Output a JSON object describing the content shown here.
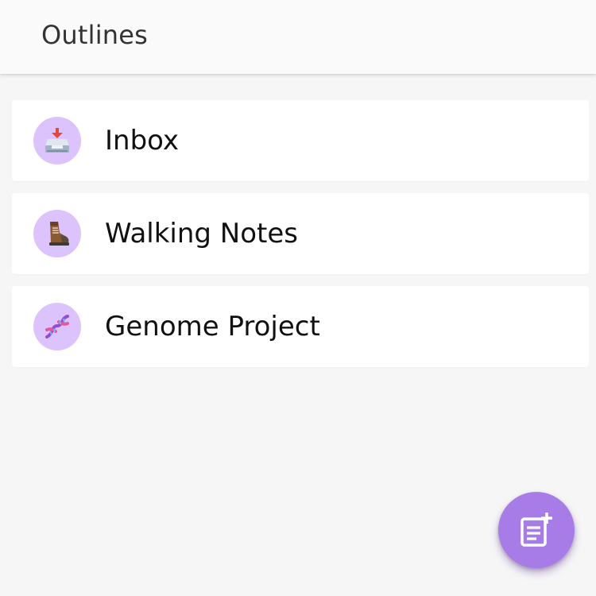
{
  "header": {
    "title": "Outlines"
  },
  "outlines": [
    {
      "label": "Inbox",
      "icon": "inbox-tray-icon"
    },
    {
      "label": "Walking Notes",
      "icon": "hiking-boot-icon"
    },
    {
      "label": "Genome Project",
      "icon": "dna-icon"
    }
  ],
  "fab": {
    "icon": "new-note-icon"
  },
  "colors": {
    "accent": "#a77ce6",
    "avatar_bg": "#dcc3fb",
    "background": "#f6f6f7",
    "card": "#ffffff"
  }
}
